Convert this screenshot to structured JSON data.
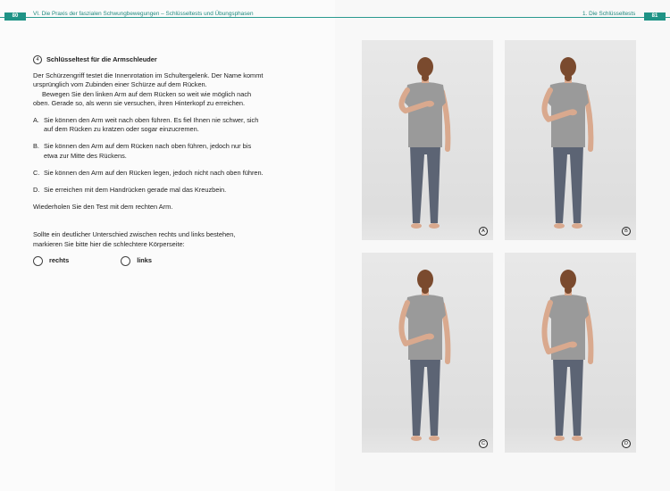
{
  "header": {
    "left_page_number": "80",
    "left_running_title": "VI. Die Praxis der faszialen Schwungbewegungen – Schlüsseltests und Übungsphasen",
    "right_running_title": "1. Die Schlüsseltests",
    "right_page_number": "81"
  },
  "test": {
    "number": "4",
    "title": "Schlüsseltest für die Armschleuder",
    "intro_1": "Der Schürzengriff testet die Innenrotation im Schultergelenk. Der Name kommt ursprünglich vom Zubinden einer Schürze auf dem Rücken.",
    "intro_2": "Bewegen Sie den linken Arm auf dem Rücken so weit wie möglich nach oben. Gerade so, als wenn sie versuchen, ihren Hinterkopf zu erreichen.",
    "options": [
      {
        "letter": "A.",
        "text": "Sie können den Arm weit nach oben führen. Es fiel Ihnen nie schwer, sich auf dem Rücken zu kratzen oder sogar einzucremen."
      },
      {
        "letter": "B.",
        "text": "Sie können den Arm auf dem Rücken nach oben führen, jedoch nur bis etwa zur Mitte des Rückens."
      },
      {
        "letter": "C.",
        "text": "Sie können den Arm auf den Rücken legen, jedoch nicht nach oben führen."
      },
      {
        "letter": "D.",
        "text": "Sie erreichen mit dem Handrücken gerade mal das Kreuzbein."
      }
    ],
    "repeat": "Wiederholen Sie den Test mit dem rechten Arm.",
    "difference": "Sollte ein deutlicher Unterschied zwischen rechts und links bestehen, markieren Sie bitte hier die schlechtere Körperseite:",
    "choice_right": "rechts",
    "choice_left": "links"
  },
  "photos": [
    {
      "label": "A",
      "hand_level": 0.22
    },
    {
      "label": "B",
      "hand_level": 0.38
    },
    {
      "label": "C",
      "hand_level": 0.6
    },
    {
      "label": "D",
      "hand_level": 0.75
    }
  ],
  "colors": {
    "accent": "#1f9386",
    "shirt": "#9a9a9a",
    "leggings": "#5c6474",
    "hair": "#7a4a2e",
    "skin": "#d9a98e"
  }
}
